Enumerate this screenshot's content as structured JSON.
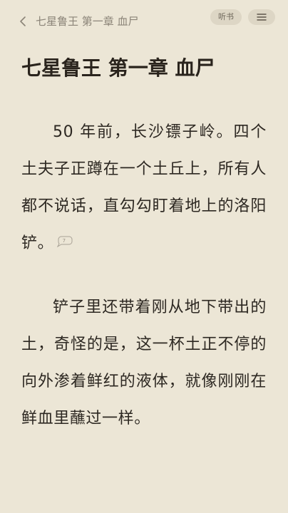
{
  "header": {
    "breadcrumb": "七星鲁王 第一章 血尸",
    "listen_label": "听书",
    "menu_icon": "hamburger-menu-icon",
    "back_icon": "chevron-left-icon"
  },
  "chapter": {
    "title": "七星鲁王 第一章 血尸",
    "paragraphs": [
      "50 年前，长沙镖子岭。四个土夫子正蹲在一个土丘上，所有人都不说话，直勾勾盯着地上的洛阳铲。",
      "铲子里还带着刚从地下带出的土，奇怪的是，这一杯土正不停的向外渗着鲜红的液体，就像刚刚在鲜血里蘸过一样。"
    ],
    "comment_count": "7"
  },
  "colors": {
    "background": "#ece6d6",
    "text": "#2d2822",
    "muted": "#8b8478",
    "pill": "#ddd6c5"
  }
}
